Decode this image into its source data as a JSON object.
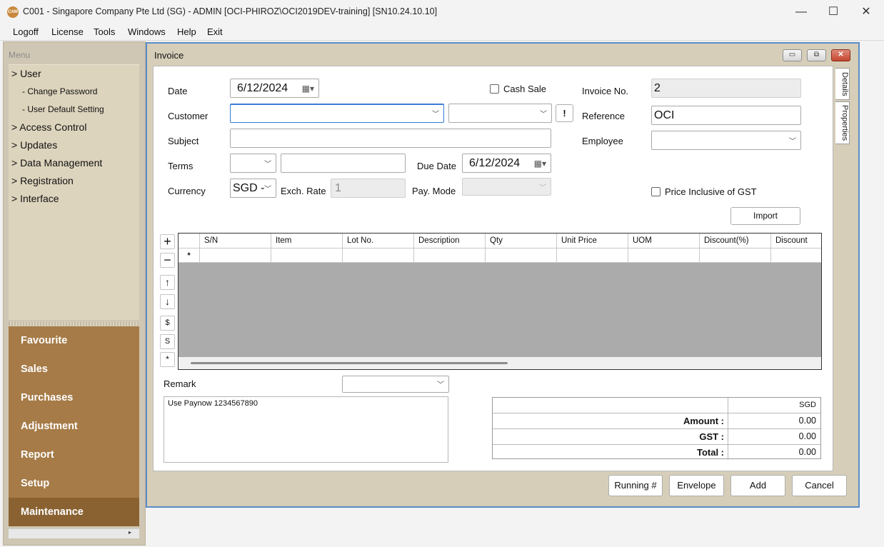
{
  "window": {
    "logo_text": "CAM",
    "title": "C001 - Singapore Company Pte Ltd (SG) - ADMIN [OCI-PHIROZ\\OCI2019DEV-training] [SN10.24.10.10]",
    "minimize": "—",
    "maximize": "☐",
    "close": "✕"
  },
  "menubar": [
    "Logoff",
    "License",
    "Tools",
    "Windows",
    "Help",
    "Exit"
  ],
  "sidebar": {
    "header": "Menu",
    "tree": [
      {
        "label": "> User",
        "level": 0
      },
      {
        "label": "- Change Password",
        "level": 1
      },
      {
        "label": "- User Default Setting",
        "level": 1
      },
      {
        "label": "> Access Control",
        "level": 0
      },
      {
        "label": "> Updates",
        "level": 0
      },
      {
        "label": "> Data Management",
        "level": 0
      },
      {
        "label": "> Registration",
        "level": 0
      },
      {
        "label": "> Interface",
        "level": 0
      }
    ],
    "categories": [
      "Favourite",
      "Sales",
      "Purchases",
      "Adjustment",
      "Report",
      "Setup",
      "Maintenance"
    ],
    "selected_category": "Maintenance"
  },
  "invoice": {
    "title": "Invoice",
    "side_tabs": [
      "Details",
      "Properties"
    ],
    "labels": {
      "date": "Date",
      "customer": "Customer",
      "subject": "Subject",
      "terms": "Terms",
      "currency": "Currency",
      "exch_rate": "Exch. Rate",
      "due_date": "Due Date",
      "pay_mode": "Pay. Mode",
      "cash_sale": "Cash Sale",
      "invoice_no": "Invoice No.",
      "reference": "Reference",
      "employee": "Employee",
      "price_incl_gst": "Price Inclusive of GST",
      "remark": "Remark"
    },
    "values": {
      "date": "6/12/2024",
      "customer": "",
      "customer_code": "",
      "subject": "",
      "terms": "",
      "terms_desc": "",
      "currency": "SGD -",
      "exch_rate": "1",
      "due_date": "6/12/2024",
      "pay_mode": "",
      "cash_sale": false,
      "invoice_no": "2",
      "reference": "OCI",
      "employee": "",
      "price_incl_gst": false,
      "remark_template": "",
      "remark_text": "Use Paynow 1234567890"
    },
    "buttons": {
      "customer_lookup": "!",
      "import": "Import",
      "running": "Running #",
      "envelope": "Envelope",
      "add": "Add",
      "cancel": "Cancel"
    },
    "grid": {
      "columns": [
        "S/N",
        "Item",
        "Lot No.",
        "Description",
        "Qty",
        "Unit Price",
        "UOM",
        "Discount(%)",
        "Discount"
      ],
      "new_row_marker": "*",
      "tools": [
        "+",
        "−",
        "↑",
        "↓",
        "$",
        "S",
        "*"
      ]
    },
    "totals": {
      "currency": "SGD",
      "rows": [
        {
          "label": "Amount :",
          "value": "0.00"
        },
        {
          "label": "GST :",
          "value": "0.00"
        },
        {
          "label": "Total :",
          "value": "0.00"
        }
      ]
    }
  }
}
